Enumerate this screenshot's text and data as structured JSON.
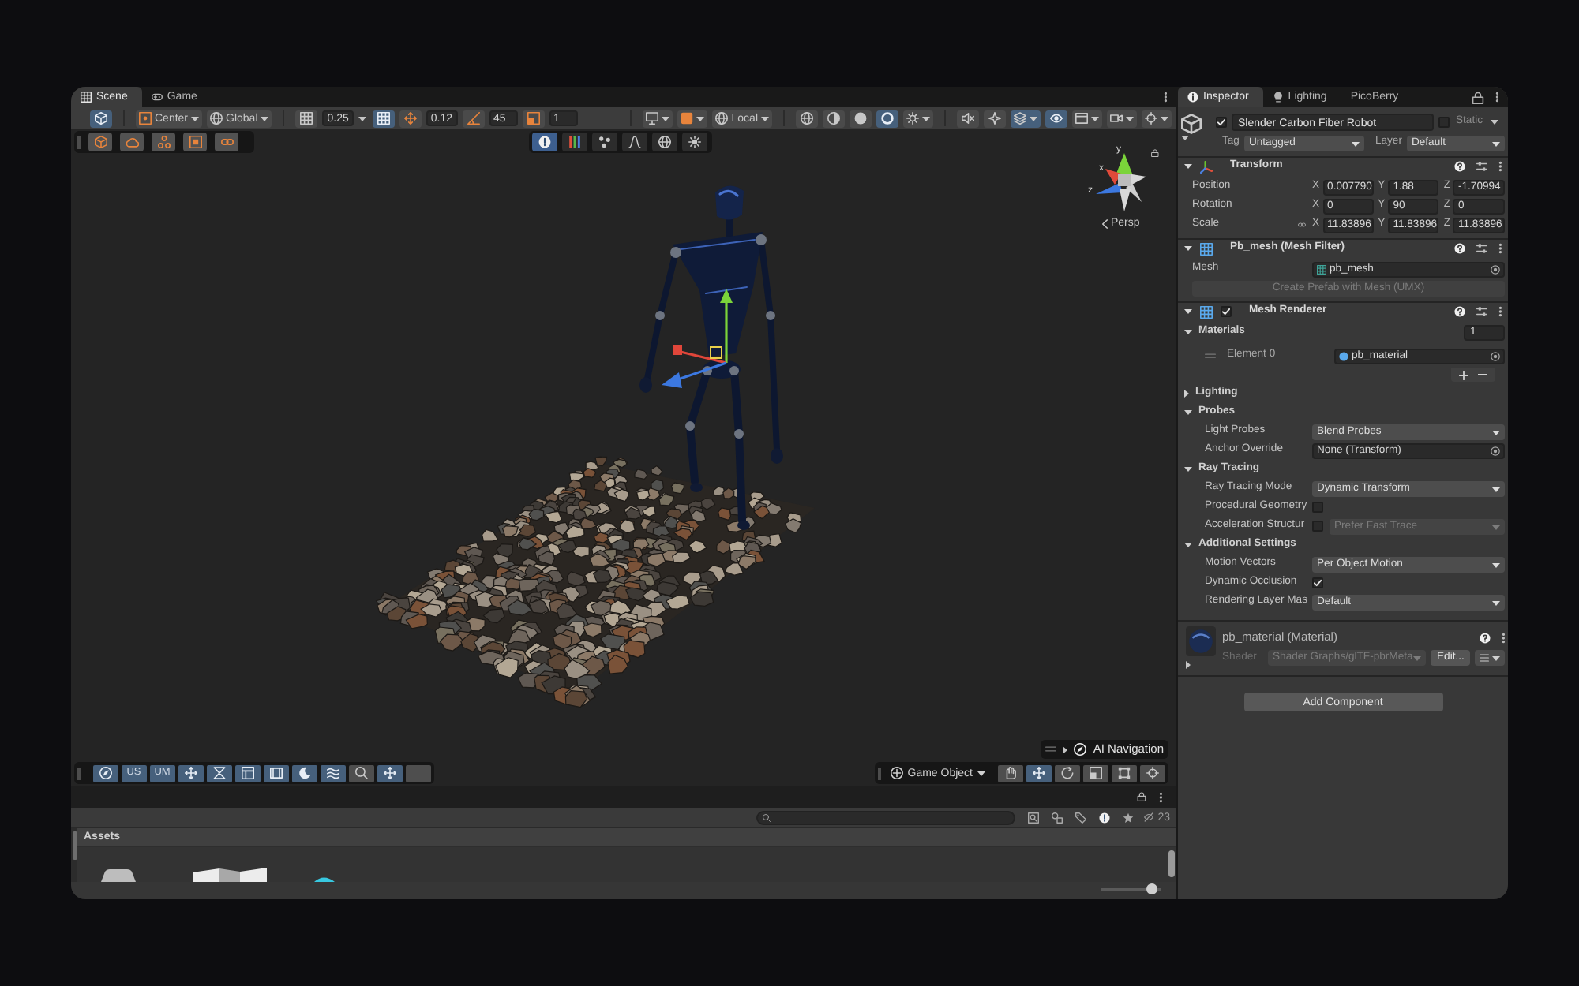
{
  "scene_panel": {
    "tabs": [
      {
        "label": "Scene",
        "selected": true
      },
      {
        "label": "Game",
        "selected": false
      }
    ],
    "toolbar": [
      [
        {
          "kind": "toggle",
          "selected": true
        }
      ],
      [
        {
          "kind": "dropdown",
          "label": "Center",
          "selected": false
        },
        {
          "kind": "dropdown",
          "label": "Global",
          "selected": false
        }
      ],
      [
        {
          "kind": "toggle",
          "selected": false
        },
        {
          "kind": "field",
          "value": "0.25"
        },
        {
          "kind": "caret"
        },
        {
          "kind": "toggle",
          "selected": true
        },
        {
          "kind": "toggle",
          "selected": false
        },
        {
          "kind": "field",
          "value": "0.12"
        },
        {
          "kind": "toggle",
          "selected": false
        },
        {
          "kind": "field",
          "value": "45"
        },
        {
          "kind": "toggle",
          "selected": false
        },
        {
          "kind": "field",
          "value": "1"
        }
      ],
      [
        {
          "kind": "dropdown",
          "selected": false
        },
        {
          "kind": "dropdown",
          "selected": false
        },
        {
          "kind": "dropdown",
          "label": "Local",
          "selected": false
        }
      ],
      [
        {
          "kind": "toggle",
          "selected": false
        },
        {
          "kind": "toggle",
          "selected": false
        },
        {
          "kind": "toggle",
          "selected": false
        },
        {
          "kind": "toggle",
          "selected": true
        },
        {
          "kind": "dropdown",
          "selected": false
        }
      ],
      [
        {
          "kind": "toggle",
          "selected": false
        },
        {
          "kind": "toggle",
          "selected": false
        },
        {
          "kind": "dropdown",
          "selected": true
        },
        {
          "kind": "toggle",
          "selected": true
        },
        {
          "kind": "dropdown",
          "selected": false
        },
        {
          "kind": "dropdown",
          "selected": false
        },
        {
          "kind": "dropdown",
          "selected": false
        }
      ]
    ],
    "overlay_tools": [
      {
        "selected": false
      },
      {
        "selected": false
      },
      {
        "selected": false
      },
      {
        "selected": false
      },
      {
        "selected": false
      }
    ],
    "view_options": [
      {
        "selected": true
      },
      {
        "selected": false
      },
      {
        "selected": false
      },
      {
        "selected": false
      },
      {
        "selected": false
      },
      {
        "selected": false
      }
    ],
    "orientation_gizmo": {
      "axes": [
        {
          "label": "y"
        },
        {
          "label": "x"
        },
        {
          "label": "z"
        }
      ],
      "projection": "Persp"
    },
    "ai_navigation": {
      "title": "AI Navigation",
      "expanded": false
    },
    "bottom_tools": [
      {
        "kind": "toggle",
        "selected": true
      },
      {
        "kind": "text",
        "label": "US",
        "selected": true
      },
      {
        "kind": "text",
        "label": "UM",
        "selected": true
      },
      {
        "kind": "toggle",
        "selected": true
      },
      {
        "kind": "toggle",
        "selected": true
      },
      {
        "kind": "toggle",
        "selected": true
      },
      {
        "kind": "toggle",
        "selected": true
      },
      {
        "kind": "toggle",
        "selected": true
      },
      {
        "kind": "toggle",
        "selected": true
      },
      {
        "kind": "toggle",
        "selected": false
      },
      {
        "kind": "toggle",
        "selected": true
      },
      {
        "kind": "toggle",
        "selected": false
      }
    ],
    "transform_tools": {
      "mode": "Game Object",
      "tools": [
        {
          "selected": false
        },
        {
          "selected": true
        },
        {
          "selected": false
        },
        {
          "selected": false
        },
        {
          "selected": false
        },
        {
          "selected": false
        }
      ]
    }
  },
  "project_panel": {
    "hidden_count": "23",
    "folder": "Assets",
    "size_slider": {
      "level": 0.94
    }
  },
  "inspector": {
    "tabs": [
      {
        "label": "Inspector",
        "selected": true
      },
      {
        "label": "Lighting",
        "selected": false
      },
      {
        "label": "PicoBerry",
        "selected": false
      }
    ],
    "game_object": {
      "active": true,
      "name": "Slender Carbon Fiber Robot",
      "static": false,
      "static_label": "Static",
      "tag_label": "Tag",
      "tag": "Untagged",
      "layer_label": "Layer",
      "layer": "Default"
    },
    "transform": {
      "title": "Transform",
      "expanded": true,
      "rows": [
        {
          "label": "Position",
          "values": [
            {
              "axis": "X",
              "value": "0.007790"
            },
            {
              "axis": "Y",
              "value": "1.88"
            },
            {
              "axis": "Z",
              "value": "-1.70994"
            }
          ]
        },
        {
          "label": "Rotation",
          "values": [
            {
              "axis": "X",
              "value": "0"
            },
            {
              "axis": "Y",
              "value": "90"
            },
            {
              "axis": "Z",
              "value": "0"
            }
          ]
        },
        {
          "label": "Scale",
          "values": [
            {
              "axis": "X",
              "value": "11.83896"
            },
            {
              "axis": "Y",
              "value": "11.83896"
            },
            {
              "axis": "Z",
              "value": "11.83896"
            }
          ]
        }
      ]
    },
    "mesh_filter": {
      "title": "Pb_mesh (Mesh Filter)",
      "expanded": true,
      "mesh_label": "Mesh",
      "mesh": "pb_mesh",
      "button": {
        "label": "Create Prefab with Mesh (UMX)",
        "disabled": true
      }
    },
    "mesh_renderer": {
      "title": "Mesh Renderer",
      "enabled": true,
      "expanded": true,
      "materials": {
        "title": "Materials",
        "expanded": true,
        "count": "1",
        "elements": [
          {
            "label": "Element 0",
            "value": "pb_material"
          }
        ]
      },
      "sections": [
        {
          "title": "Lighting",
          "expanded": false
        },
        {
          "title": "Probes",
          "expanded": true,
          "rows": [
            {
              "kind": "dropdown",
              "label": "Light Probes",
              "value": "Blend Probes"
            },
            {
              "kind": "object",
              "label": "Anchor Override",
              "value": "None (Transform)"
            }
          ]
        },
        {
          "title": "Ray Tracing",
          "expanded": true,
          "rows": [
            {
              "kind": "dropdown",
              "label": "Ray Tracing Mode",
              "value": "Dynamic Transform"
            },
            {
              "kind": "checkbox",
              "label": "Procedural Geometry",
              "checked": false
            },
            {
              "kind": "checkbox_dropdown",
              "label": "Acceleration Structur",
              "checked": false,
              "value": "Prefer Fast Trace"
            }
          ]
        },
        {
          "title": "Additional Settings",
          "expanded": true,
          "rows": [
            {
              "kind": "dropdown",
              "label": "Motion Vectors",
              "value": "Per Object Motion"
            },
            {
              "kind": "checkbox",
              "label": "Dynamic Occlusion",
              "checked": true
            },
            {
              "kind": "dropdown",
              "label": "Rendering Layer Mas",
              "value": "Default"
            }
          ]
        }
      ]
    },
    "material": {
      "name": "pb_material (Material)",
      "expanded": false,
      "shader_label": "Shader",
      "shader": "Shader Graphs/glTF-pbrMeta",
      "shader_disabled": true,
      "edit_button": "Edit..."
    },
    "add_component": "Add Component"
  }
}
